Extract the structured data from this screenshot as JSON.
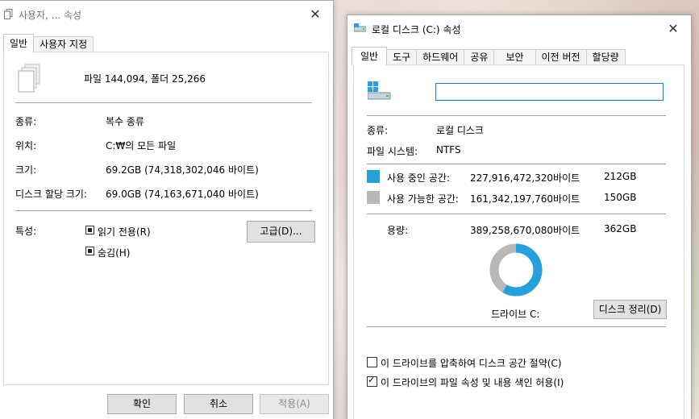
{
  "left_window": {
    "title": "사용자, ... 속성",
    "tabs": [
      "일반",
      "사용자 지정"
    ],
    "file_summary": "파일 144,094, 폴더 25,266",
    "fields": [
      {
        "label": "종류:",
        "value": "복수 종류"
      },
      {
        "label": "위치:",
        "value": "C:₩의 모든 파일"
      },
      {
        "label": "크기:",
        "value": "69.2GB (74,318,302,046 바이트)"
      },
      {
        "label": "디스크 할당 크기:",
        "value": "69.0GB (74,163,671,040 바이트)"
      }
    ],
    "attributes_label": "특성:",
    "attr_readonly": "읽기 전용(R)",
    "attr_hidden": "숨김(H)",
    "advanced_button": "고급(D)...",
    "ok_button": "확인",
    "cancel_button": "취소",
    "apply_button": "적용(A)"
  },
  "right_window": {
    "title": "로컬 디스크 (C:) 속성",
    "tabs": [
      "일반",
      "도구",
      "하드웨어",
      "공유",
      "보안",
      "이전 버전",
      "할당량"
    ],
    "name_input_value": "",
    "type_label": "종류:",
    "type_value": "로컬 디스크",
    "fs_label": "파일 시스템:",
    "fs_value": "NTFS",
    "used_label": "사용 중인 공간:",
    "used_bytes": "227,916,472,320바이트",
    "used_gb": "212GB",
    "free_label": "사용 가능한 공간:",
    "free_bytes": "161,342,197,760바이트",
    "free_gb": "150GB",
    "capacity_label": "용량:",
    "capacity_bytes": "389,258,670,080바이트",
    "capacity_gb": "362GB",
    "drive_label": "드라이브 C:",
    "cleanup_button": "디스크 정리(D)",
    "compress_label": "이 드라이브를 압축하여 디스크 공간 절약(C)",
    "index_label": "이 드라이브의 파일 속성 및 내용 색인 허용(I)",
    "used_fraction": 0.5855,
    "colors": {
      "used": "#26a0da",
      "free": "#b8b8b8"
    }
  }
}
